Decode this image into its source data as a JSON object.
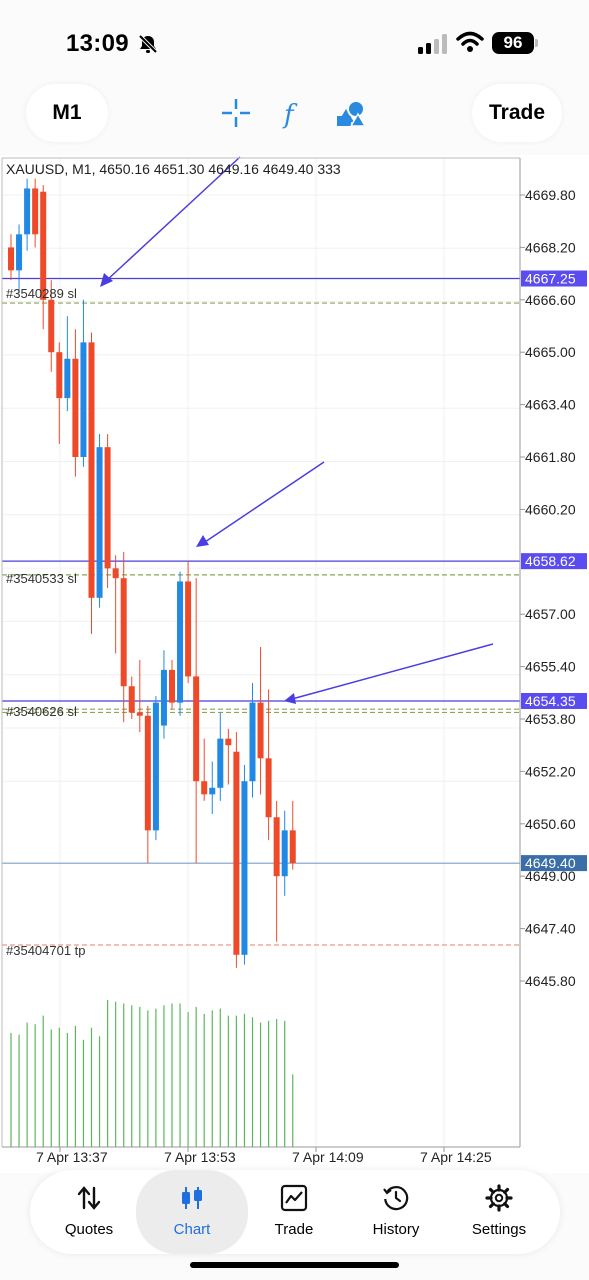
{
  "status_bar": {
    "time": "13:09",
    "battery": "96"
  },
  "toolbar": {
    "timeframe": "M1",
    "trade_label": "Trade"
  },
  "chart_header": "XAUUSD, M1, 4650.16 4651.30 4649.16 4649.40 333",
  "price_axis": {
    "ticks": [
      "4669.80",
      "4668.20",
      "4666.60",
      "4665.00",
      "4663.40",
      "4661.80",
      "4660.20",
      "4657.00",
      "4655.40",
      "4653.80",
      "4652.20",
      "4650.60",
      "4649.00",
      "4647.40",
      "4645.80"
    ],
    "badges": [
      {
        "label": "4667.25",
        "color": "#5b4cf0"
      },
      {
        "label": "4658.62",
        "color": "#5b4cf0"
      },
      {
        "label": "4654.35",
        "color": "#5b4cf0"
      },
      {
        "label": "4649.40",
        "color": "#3a6ea8"
      }
    ]
  },
  "time_axis": [
    "7 Apr 13:37",
    "7 Apr 13:53",
    "7 Apr 14:09",
    "7 Apr 14:25"
  ],
  "order_labels": [
    {
      "text": "#3540289 sl"
    },
    {
      "text": "#3540533 sl"
    },
    {
      "text": "#3540626 sl"
    },
    {
      "text": "#35404701 tp"
    }
  ],
  "colors": {
    "bull": "#2089e6",
    "bear": "#ee4a2a",
    "volume": "#5cb85c",
    "level_line": "#4a3ee0",
    "bid_line": "#3a6ea8",
    "sl_line": "#8aa657",
    "tp_line": "#e89a86"
  },
  "chart_data": {
    "type": "candlestick",
    "symbol": "XAUUSD",
    "timeframe": "M1",
    "ylim": [
      4645.2,
      4670.8
    ],
    "open_high_low_close_last": {
      "open": 4650.16,
      "high": 4651.3,
      "low": 4649.16,
      "close": 4649.4,
      "volume": 333
    },
    "candles": [
      {
        "o": 4668.2,
        "h": 4668.6,
        "l": 4667.2,
        "c": 4667.5
      },
      {
        "o": 4667.5,
        "h": 4668.9,
        "l": 4666.8,
        "c": 4668.6
      },
      {
        "o": 4668.6,
        "h": 4670.3,
        "l": 4668.1,
        "c": 4670.0
      },
      {
        "o": 4670.0,
        "h": 4670.3,
        "l": 4668.2,
        "c": 4668.6
      },
      {
        "o": 4669.9,
        "h": 4670.1,
        "l": 4665.7,
        "c": 4666.6
      },
      {
        "o": 4666.6,
        "h": 4667.2,
        "l": 4664.4,
        "c": 4665.0
      },
      {
        "o": 4665.0,
        "h": 4665.3,
        "l": 4662.2,
        "c": 4663.6
      },
      {
        "o": 4663.6,
        "h": 4666.1,
        "l": 4663.2,
        "c": 4664.8
      },
      {
        "o": 4664.8,
        "h": 4665.7,
        "l": 4661.2,
        "c": 4661.8
      },
      {
        "o": 4661.8,
        "h": 4666.6,
        "l": 4661.5,
        "c": 4665.3
      },
      {
        "o": 4665.3,
        "h": 4665.6,
        "l": 4656.4,
        "c": 4657.5
      },
      {
        "o": 4657.5,
        "h": 4662.5,
        "l": 4657.2,
        "c": 4662.1
      },
      {
        "o": 4662.1,
        "h": 4662.5,
        "l": 4657.8,
        "c": 4658.4
      },
      {
        "o": 4658.4,
        "h": 4658.8,
        "l": 4655.8,
        "c": 4658.1
      },
      {
        "o": 4658.1,
        "h": 4658.9,
        "l": 4653.7,
        "c": 4654.8
      },
      {
        "o": 4654.8,
        "h": 4655.1,
        "l": 4653.8,
        "c": 4654.0
      },
      {
        "o": 4654.0,
        "h": 4655.6,
        "l": 4653.4,
        "c": 4653.9
      },
      {
        "o": 4653.9,
        "h": 4654.2,
        "l": 4649.4,
        "c": 4650.4
      },
      {
        "o": 4650.4,
        "h": 4654.5,
        "l": 4650.1,
        "c": 4654.3
      },
      {
        "o": 4653.6,
        "h": 4655.9,
        "l": 4653.2,
        "c": 4655.3
      },
      {
        "o": 4655.3,
        "h": 4655.6,
        "l": 4654.1,
        "c": 4654.3
      },
      {
        "o": 4654.3,
        "h": 4658.3,
        "l": 4653.9,
        "c": 4658.0
      },
      {
        "o": 4658.0,
        "h": 4658.6,
        "l": 4654.9,
        "c": 4655.1
      },
      {
        "o": 4655.1,
        "h": 4658.1,
        "l": 4649.4,
        "c": 4651.9
      },
      {
        "o": 4651.9,
        "h": 4653.2,
        "l": 4651.3,
        "c": 4651.5
      },
      {
        "o": 4651.5,
        "h": 4652.5,
        "l": 4650.9,
        "c": 4651.7
      },
      {
        "o": 4651.7,
        "h": 4654.0,
        "l": 4651.3,
        "c": 4653.2
      },
      {
        "o": 4653.2,
        "h": 4653.5,
        "l": 4651.8,
        "c": 4653.0
      },
      {
        "o": 4652.8,
        "h": 4653.4,
        "l": 4646.2,
        "c": 4646.6
      },
      {
        "o": 4646.6,
        "h": 4652.4,
        "l": 4646.3,
        "c": 4651.9
      },
      {
        "o": 4651.9,
        "h": 4654.9,
        "l": 4651.4,
        "c": 4654.3
      },
      {
        "o": 4654.3,
        "h": 4656.0,
        "l": 4651.5,
        "c": 4652.6
      },
      {
        "o": 4652.6,
        "h": 4654.7,
        "l": 4650.1,
        "c": 4650.8
      },
      {
        "o": 4650.8,
        "h": 4651.3,
        "l": 4647.0,
        "c": 4649.0
      },
      {
        "o": 4649.0,
        "h": 4651.0,
        "l": 4648.4,
        "c": 4650.4
      },
      {
        "o": 4650.4,
        "h": 4651.3,
        "l": 4649.2,
        "c": 4649.4
      }
    ],
    "volumes": [
      330,
      325,
      360,
      355,
      380,
      340,
      345,
      330,
      350,
      310,
      345,
      320,
      425,
      420,
      415,
      410,
      405,
      395,
      400,
      410,
      415,
      415,
      390,
      405,
      385,
      395,
      400,
      380,
      380,
      385,
      375,
      360,
      365,
      370,
      365,
      210
    ],
    "levels": [
      {
        "price": 4667.25,
        "kind": "level"
      },
      {
        "price": 4658.62,
        "kind": "level"
      },
      {
        "price": 4654.35,
        "kind": "level"
      },
      {
        "price": 4649.4,
        "kind": "bid"
      },
      {
        "price": 4666.5,
        "kind": "sl"
      },
      {
        "price": 4658.2,
        "kind": "sl"
      },
      {
        "price": 4654.1,
        "kind": "sl"
      },
      {
        "price": 4654.0,
        "kind": "sl"
      },
      {
        "price": 4646.9,
        "kind": "tp"
      }
    ]
  },
  "nav": {
    "items": [
      {
        "label": "Quotes"
      },
      {
        "label": "Chart"
      },
      {
        "label": "Trade"
      },
      {
        "label": "History"
      },
      {
        "label": "Settings"
      }
    ]
  }
}
